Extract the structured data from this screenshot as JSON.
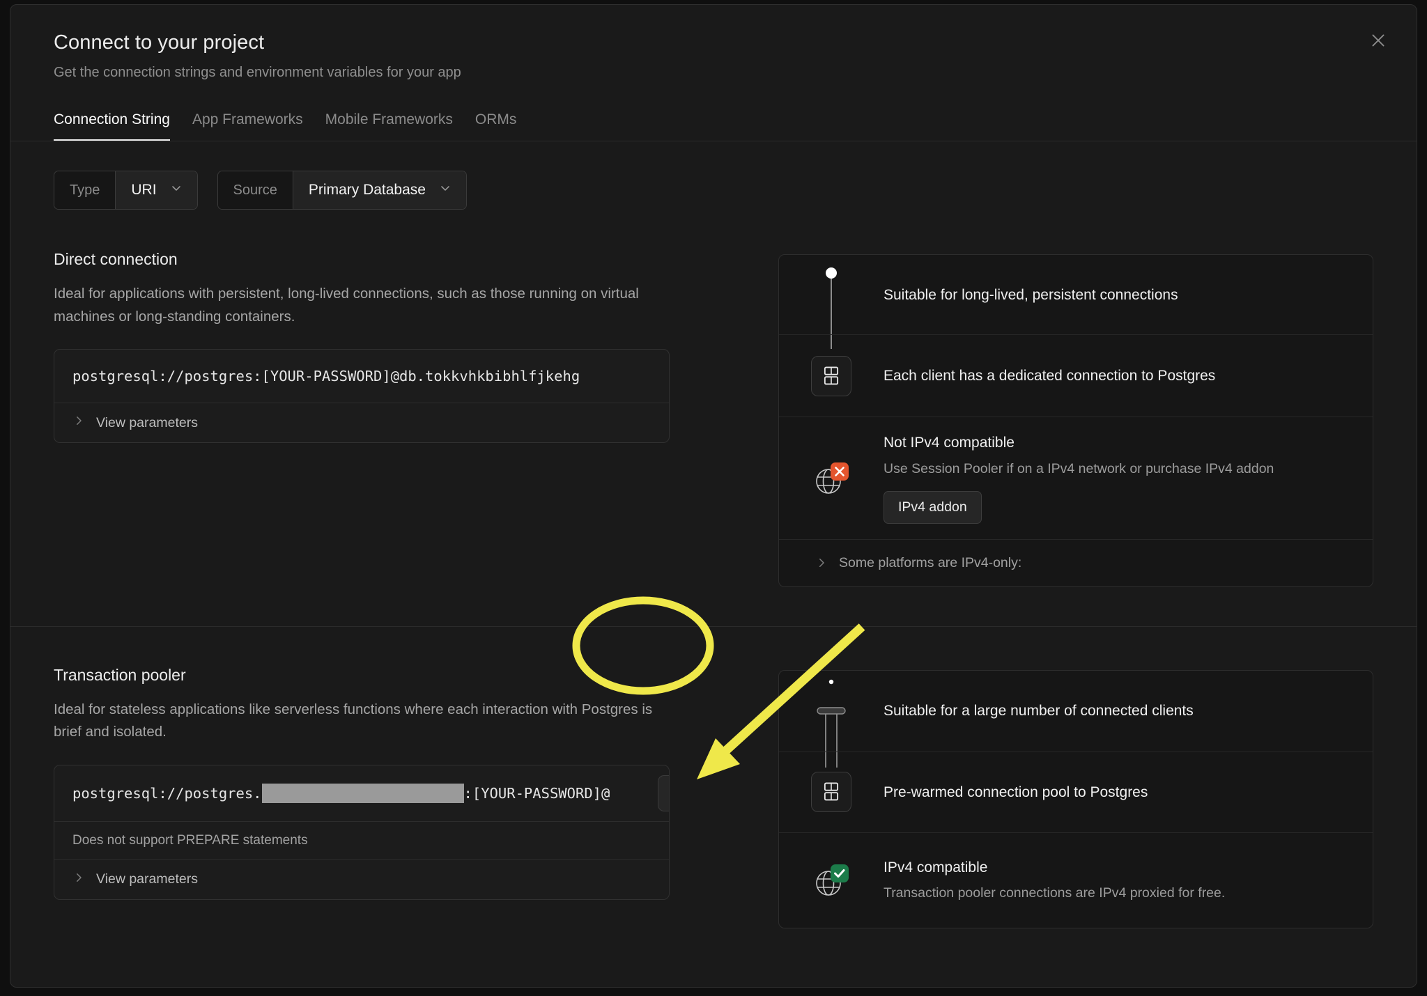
{
  "dialog": {
    "title": "Connect to your project",
    "subtitle": "Get the connection strings and environment variables for your app",
    "close_icon": "close-icon"
  },
  "tabs": [
    {
      "label": "Connection String",
      "active": true
    },
    {
      "label": "App Frameworks",
      "active": false
    },
    {
      "label": "Mobile Frameworks",
      "active": false
    },
    {
      "label": "ORMs",
      "active": false
    }
  ],
  "selectors": [
    {
      "label": "Type",
      "value": "URI",
      "icon": "chevron-down-icon"
    },
    {
      "label": "Source",
      "value": "Primary Database",
      "icon": "chevron-down-icon"
    }
  ],
  "direct_connection": {
    "title": "Direct connection",
    "description": "Ideal for applications with persistent, long-lived connections, such as those running on virtual machines or long-standing containers.",
    "connection_string": "postgresql://postgres:[YOUR-PASSWORD]@db.tokkvhkbibhlfjkehg",
    "view_parameters_label": "View parameters",
    "view_parameters_icon": "chevron-right-icon",
    "features": [
      {
        "icon": "dot-connector-icon",
        "title": "Suitable for long-lived, persistent connections",
        "subtitle": "",
        "button": ""
      },
      {
        "icon": "database-icon",
        "title": "Each client has a dedicated connection to Postgres",
        "subtitle": "",
        "button": ""
      },
      {
        "icon": "globe-error-icon",
        "title": "Not IPv4 compatible",
        "subtitle": "Use Session Pooler if on a IPv4 network or purchase IPv4 addon",
        "button": "IPv4 addon"
      }
    ],
    "expand_row": {
      "label": "Some platforms are IPv4-only:",
      "icon": "chevron-right-icon"
    }
  },
  "transaction_pooler": {
    "title": "Transaction pooler",
    "description": "Ideal for stateless applications like serverless functions where each interaction with Postgres is brief and isolated.",
    "connection_prefix": "postgresql://postgres.",
    "connection_redacted": "[REDACTED]",
    "connection_suffix": ":[YOUR-PASSWORD]@",
    "note": "Does not support PREPARE statements",
    "view_parameters_label": "View parameters",
    "view_parameters_icon": "chevron-right-icon",
    "copy_icon": "copy-icon",
    "features": [
      {
        "icon": "multi-client-icon",
        "title": "Suitable for a large number of connected clients",
        "subtitle": "",
        "button": ""
      },
      {
        "icon": "database-icon",
        "title": "Pre-warmed connection pool to Postgres",
        "subtitle": "",
        "button": ""
      },
      {
        "icon": "globe-success-icon",
        "title": "IPv4 compatible",
        "subtitle": "Transaction pooler connections are IPv4 proxied for free.",
        "button": ""
      }
    ]
  },
  "annotation": {
    "highlight_color": "#EFE84A",
    "shape": "ellipse-and-arrow",
    "target": "copy-button"
  },
  "colors": {
    "background": "#0f0f0f",
    "dialog": "#1a1a1a",
    "accent_error": "#E4552E",
    "accent_success": "#1C7C4A",
    "highlight": "#EFE84A"
  }
}
